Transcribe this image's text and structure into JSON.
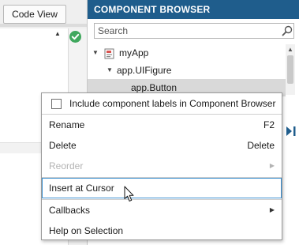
{
  "toolbar": {
    "code_view_label": "Code View"
  },
  "component_browser": {
    "title": "COMPONENT BROWSER",
    "search_placeholder": "Search",
    "tree": [
      {
        "label": "myApp",
        "expanded": true,
        "icon": "app-file-icon"
      },
      {
        "label": "app.UIFigure",
        "expanded": true
      },
      {
        "label": "app.Button",
        "selected": true
      }
    ]
  },
  "context_menu": {
    "include_labels_option": {
      "label": "Include component labels in Component Browser",
      "checked": false
    },
    "items": [
      {
        "label": "Rename",
        "shortcut": "F2",
        "enabled": true
      },
      {
        "label": "Delete",
        "shortcut": "Delete",
        "enabled": true
      },
      {
        "label": "Reorder",
        "submenu": true,
        "enabled": false
      },
      {
        "label": "Insert at Cursor",
        "enabled": true,
        "highlighted": true
      },
      {
        "label": "Callbacks",
        "submenu": true,
        "enabled": true
      },
      {
        "label": "Help on Selection",
        "enabled": true
      }
    ]
  },
  "colors": {
    "header_bg": "#1f5d8c",
    "status_ok": "#40a85e",
    "menu_highlight_border": "#3a8fcf",
    "selected_row": "#d9d9d9",
    "disabled_text": "#b3b3b3"
  }
}
